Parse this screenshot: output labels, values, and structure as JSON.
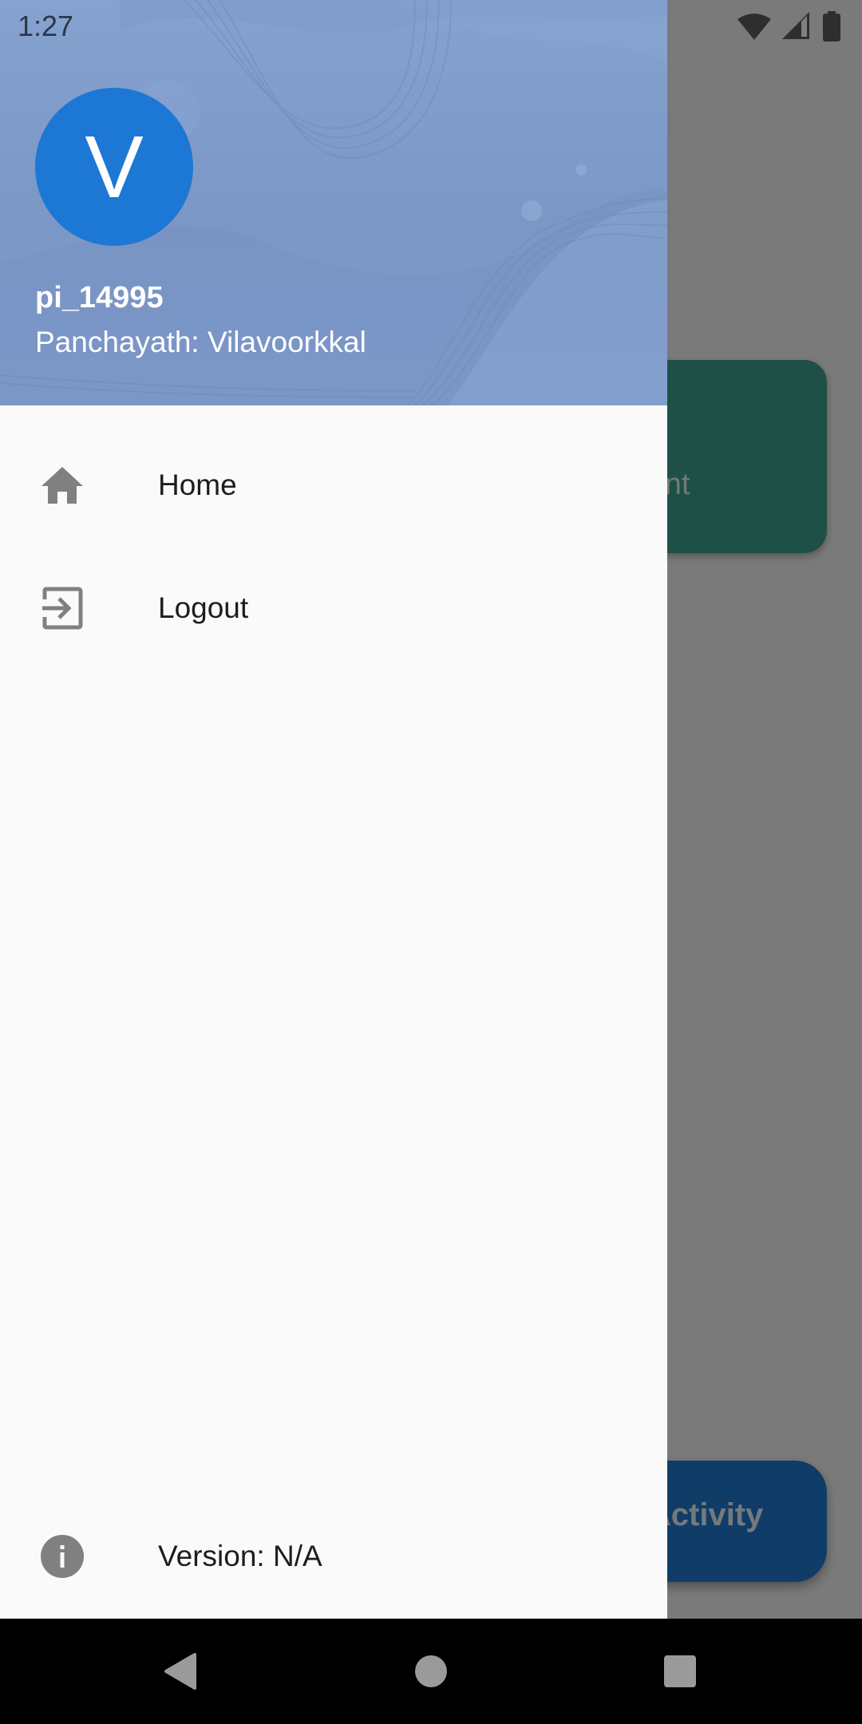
{
  "status_bar": {
    "time": "1:27",
    "icons": [
      "wifi-icon",
      "cell-signal-icon",
      "battery-icon"
    ]
  },
  "background_app": {
    "card_label_partial": "ment",
    "fab_label_partial": "k Activity",
    "colors": {
      "card": "#3ea08e",
      "fab": "#1f7bd0"
    }
  },
  "drawer": {
    "header": {
      "avatar_initial": "V",
      "user_name": "pi_14995",
      "subtitle": "Panchayath: Vilavoorkkal",
      "colors": {
        "header_bg": "#7f9ccb",
        "avatar_bg": "#1c78d4"
      }
    },
    "items": [
      {
        "icon": "home-icon",
        "label": "Home"
      },
      {
        "icon": "logout-icon",
        "label": "Logout"
      }
    ],
    "footer": {
      "icon": "info-icon",
      "label": "Version: N/A"
    }
  },
  "nav_bar": {
    "buttons": [
      "back",
      "home",
      "recents"
    ]
  }
}
